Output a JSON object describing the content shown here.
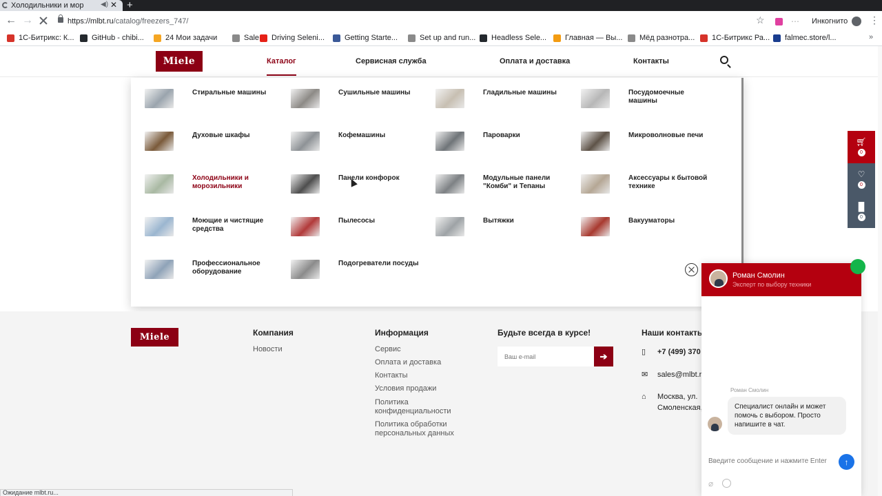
{
  "browser": {
    "tab_title": "Холодильники и мор",
    "url_host": "https://mlbt.ru",
    "url_path": "/catalog/freezers_747/",
    "incognito_label": "Инкогнито",
    "status_text": "Ожидание mlbt.ru..."
  },
  "bookmarks": [
    {
      "label": "1С-Битрикс: К...",
      "color": "#d6332a"
    },
    {
      "label": "GitHub - chibi...",
      "color": "#24292e"
    },
    {
      "label": "24  Мои задачи",
      "color": "#f5a623"
    },
    {
      "label": "Sale",
      "color": "#8a8a8a"
    },
    {
      "label": "Driving Seleni...",
      "color": "#e62117"
    },
    {
      "label": "Getting Starte...",
      "color": "#3b5998"
    },
    {
      "label": "Set up and run...",
      "color": "#8a8a8a"
    },
    {
      "label": "Headless Sele...",
      "color": "#24292e"
    },
    {
      "label": "Главная — Вы...",
      "color": "#f39c12"
    },
    {
      "label": "Мёд разнотра...",
      "color": "#8a8a8a"
    },
    {
      "label": "1С-Битрикс Ра...",
      "color": "#d6332a"
    },
    {
      "label": "falmec.store/l...",
      "color": "#1a3d8f"
    }
  ],
  "brand": {
    "logo_text": "Miele",
    "accent": "#8c0014"
  },
  "nav": {
    "catalog": "Каталог",
    "service": "Сервисная служба",
    "payment": "Оплата и доставка",
    "contacts": "Контакты"
  },
  "catalog": [
    {
      "label": "Стиральные машины",
      "thumb": "#9aa4ad"
    },
    {
      "label": "Сушильные машины",
      "thumb": "#8d8a86"
    },
    {
      "label": "Гладильные машины",
      "thumb": "#c7bfb2"
    },
    {
      "label": "Посудомоечные машины",
      "thumb": "#b7b7b7"
    },
    {
      "label": "Духовые шкафы",
      "thumb": "#7a5a3a"
    },
    {
      "label": "Кофемашины",
      "thumb": "#8e9296"
    },
    {
      "label": "Пароварки",
      "thumb": "#6f7478"
    },
    {
      "label": "Микроволновые печи",
      "thumb": "#5e5348"
    },
    {
      "label": "Холодильники и морозильники",
      "thumb": "#a9b9a3",
      "active": true
    },
    {
      "label": "Панели конфорок",
      "thumb": "#4e4e4e"
    },
    {
      "label": "Модульные панели \"Комби\" и Тепаны",
      "thumb": "#7d8184"
    },
    {
      "label": "Аксессуары к бытовой технике",
      "thumb": "#b5a795"
    },
    {
      "label": "Моющие и чистящие средства",
      "thumb": "#9bb6d0"
    },
    {
      "label": "Пылесосы",
      "thumb": "#b23a3a"
    },
    {
      "label": "Вытяжки",
      "thumb": "#9ea3a6"
    },
    {
      "label": "Вакууматоры",
      "thumb": "#a8392f"
    },
    {
      "label": "Профессиональное оборудование",
      "thumb": "#8fa3b8"
    },
    {
      "label": "Подогреватели посуды",
      "thumb": "#8b8b8b"
    }
  ],
  "side_panel": {
    "cart_count": "0",
    "fav_count": "0",
    "compare_count": "0"
  },
  "footer": {
    "company_head": "Компания",
    "company_links": [
      "Новости"
    ],
    "info_head": "Информация",
    "info_links": [
      "Сервис",
      "Оплата и доставка",
      "Контакты",
      "Условия продажи",
      "Политика конфиденциальности",
      "Политика обработки персональных данных"
    ],
    "subscribe_head": "Будьте всегда в курсе!",
    "email_placeholder": "Ваш e-mail",
    "contacts_head": "Наши контакты",
    "phone": "+7 (499) 370",
    "email": "sales@mlbt.ru",
    "address_line1": "Москва, ул.",
    "address_line2": "Смоленская,"
  },
  "chat": {
    "agent_name": "Роман Смолин",
    "agent_role": "Эксперт по выбору техники",
    "message_author": "Роман Смолин",
    "message_text": "Специалист онлайн и может помочь с выбором. Просто напишите в чат.",
    "input_placeholder": "Введите сообщение и нажмите Enter"
  }
}
